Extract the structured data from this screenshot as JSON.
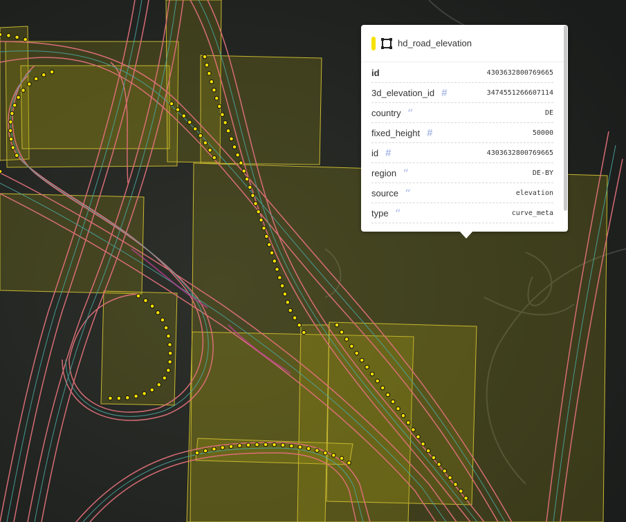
{
  "popup": {
    "layer_name": "hd_road_elevation",
    "swatch_color": "#f5e100",
    "layer_icon": "polygon-icon",
    "rows": [
      {
        "key": "id",
        "value": "4303632800769665",
        "type_icon": "none",
        "bold": true
      },
      {
        "key": "3d_elevation_id",
        "value": "3474551266607114",
        "type_icon": "number-icon"
      },
      {
        "key": "country",
        "value": "DE",
        "type_icon": "string-icon"
      },
      {
        "key": "fixed_height",
        "value": "50000",
        "type_icon": "number-icon"
      },
      {
        "key": "id",
        "value": "4303632800769665",
        "type_icon": "number-icon"
      },
      {
        "key": "region",
        "value": "DE-BY",
        "type_icon": "string-icon"
      },
      {
        "key": "source",
        "value": "elevation",
        "type_icon": "string-icon"
      },
      {
        "key": "type",
        "value": "curve_meta",
        "type_icon": "string-icon"
      }
    ]
  },
  "map": {
    "polygon_fill": "rgba(170,160,20,0.22)",
    "polygon_stroke": "#c8b830",
    "road_edge": "#e0707a",
    "road_lane": "#4aa6a0",
    "vertex_fill": "#f5e100"
  }
}
